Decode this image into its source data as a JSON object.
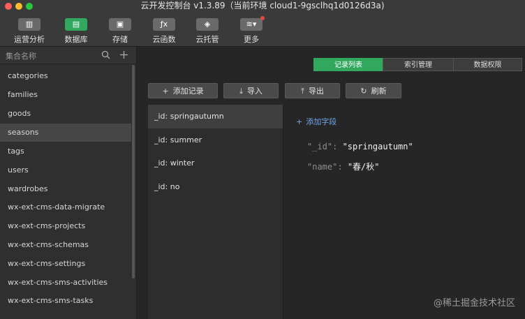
{
  "window": {
    "title": "云开发控制台 v1.3.89（当前环境 cloud1-9gsclhq1d0126d3a)",
    "traffic_lights": [
      "#fe5f57",
      "#febc2e",
      "#28c840"
    ]
  },
  "toolbar": {
    "items": [
      {
        "label": "运营分析",
        "icon": "bar-chart-icon",
        "glyph": "▥",
        "active": false
      },
      {
        "label": "数据库",
        "icon": "database-icon",
        "glyph": "▤",
        "active": true
      },
      {
        "label": "存储",
        "icon": "storage-icon",
        "glyph": "▣",
        "active": false
      },
      {
        "label": "云函数",
        "icon": "function-icon",
        "glyph": "ƒx",
        "active": false
      },
      {
        "label": "云托管",
        "icon": "cube-icon",
        "glyph": "◈",
        "active": false
      },
      {
        "label": "更多",
        "icon": "layers-icon",
        "glyph": "≋▾",
        "active": false
      }
    ]
  },
  "sidebar": {
    "search_placeholder": "集合名称",
    "collections": [
      "categories",
      "families",
      "goods",
      "seasons",
      "tags",
      "users",
      "wardrobes",
      "wx-ext-cms-data-migrate",
      "wx-ext-cms-projects",
      "wx-ext-cms-schemas",
      "wx-ext-cms-settings",
      "wx-ext-cms-sms-activities",
      "wx-ext-cms-sms-tasks"
    ],
    "selected": "seasons"
  },
  "main": {
    "tabs": [
      "记录列表",
      "索引管理",
      "数据权限"
    ],
    "active_tab": "记录列表",
    "actions": [
      {
        "label": "添加记录",
        "icon": "plus-icon",
        "glyph": "+"
      },
      {
        "label": "导入",
        "icon": "download-icon",
        "glyph": "⤓"
      },
      {
        "label": "导出",
        "icon": "upload-icon",
        "glyph": "⤒"
      },
      {
        "label": "刷新",
        "icon": "refresh-icon",
        "glyph": "↻"
      }
    ],
    "documents": [
      "_id: springautumn",
      "_id: summer",
      "_id: winter",
      "_id: no"
    ],
    "selected_document": "_id: springautumn",
    "add_field_label": "添加字段",
    "fields": [
      {
        "key": "\"_id\"",
        "value": "\"springautumn\""
      },
      {
        "key": "\"name\"",
        "value": "\"春/秋\""
      }
    ]
  },
  "watermark": "@稀土掘金技术社区"
}
